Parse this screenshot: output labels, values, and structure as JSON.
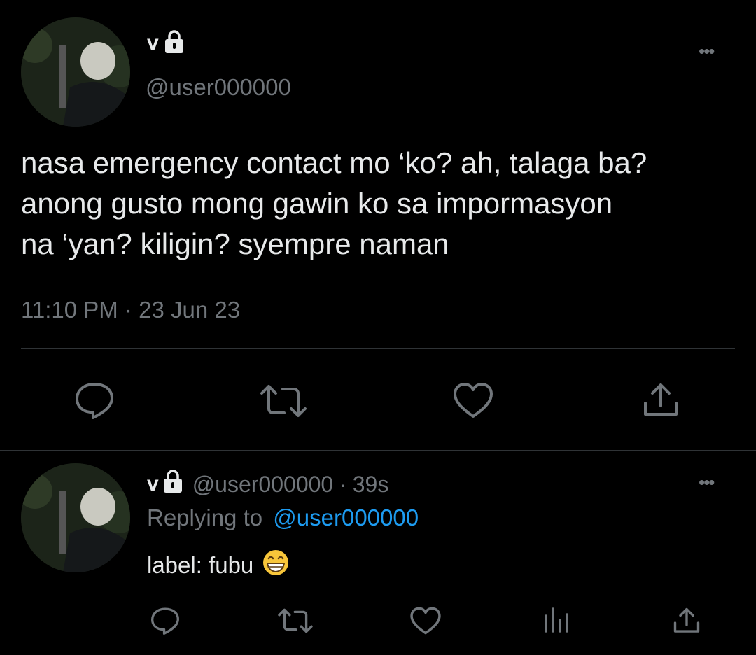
{
  "tweet": {
    "display_name": "v",
    "handle": "@user000000",
    "text_lines": [
      "nasa emergency contact mo ‘ko? ah, talaga ba?",
      "anong gusto mong gawin ko sa impormasyon",
      "na ‘yan? kiligin? syempre naman"
    ],
    "timestamp": "11:10 PM · 23 Jun 23",
    "more": "•••"
  },
  "reply": {
    "display_name": "v",
    "handle": "@user000000",
    "age": "· 39s",
    "replying_prefix": "Replying to",
    "replying_handle": "@user000000",
    "text": "label: fubu",
    "emoji": "😁",
    "more": "•••"
  },
  "icons": {
    "reply": "reply-icon",
    "retweet": "retweet-icon",
    "like": "like-icon",
    "share": "share-icon",
    "analytics": "analytics-icon",
    "lock": "lock-icon"
  },
  "colors": {
    "background": "#000000",
    "text": "#e7e9ea",
    "muted": "#71767b",
    "link": "#1d9bf0",
    "divider": "#2f3336"
  }
}
